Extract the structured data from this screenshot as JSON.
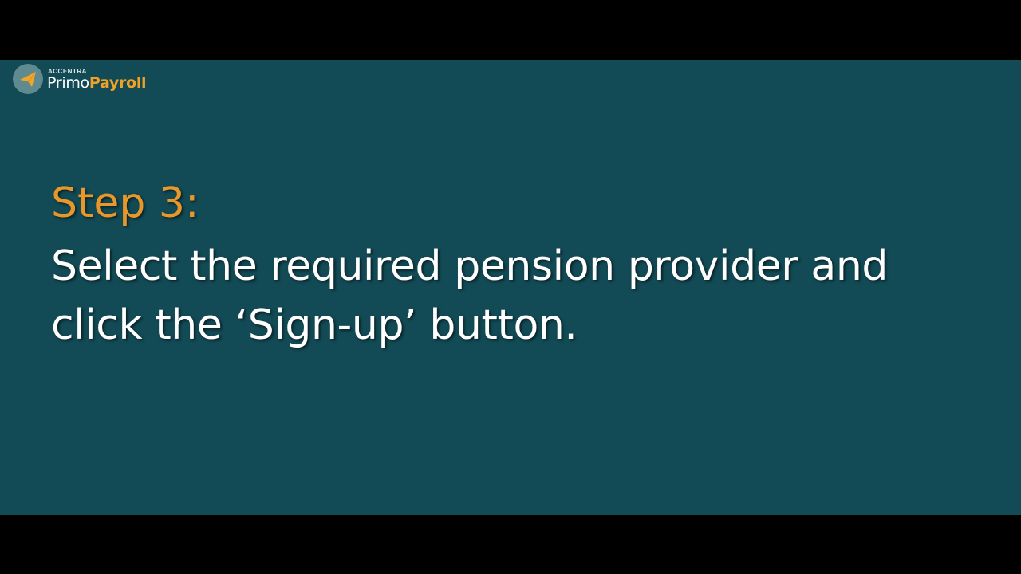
{
  "logo": {
    "kicker": "ACCENTRA",
    "primo": "Primo",
    "payroll": "Payroll",
    "icon": "paper-plane-icon"
  },
  "slide": {
    "step_label": "Step 3:",
    "instruction": "Select the required pension provider and click the ‘Sign-up’ button."
  },
  "colors": {
    "slide_background": "#124a55",
    "accent": "#e8972a",
    "text": "#ffffff",
    "letterbox": "#000000"
  }
}
